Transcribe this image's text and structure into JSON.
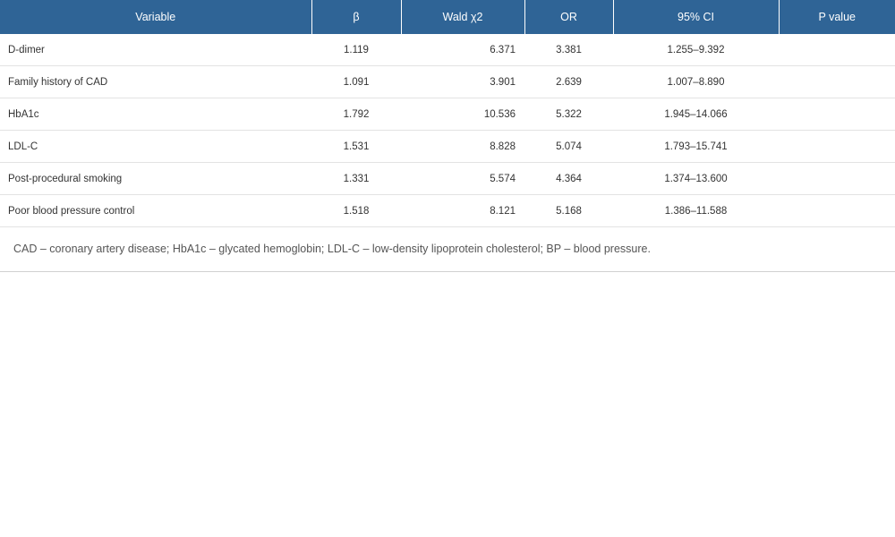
{
  "table": {
    "columns": [
      "Variable",
      "β",
      "Wald χ2",
      "OR",
      "95% CI",
      "P value"
    ],
    "rows": [
      {
        "variable": "D-dimer",
        "beta": "1.119",
        "wald": "6.371",
        "or": "3.381",
        "ci": "1.255–9.392",
        "p": ""
      },
      {
        "variable": "Family history of CAD",
        "beta": "1.091",
        "wald": "3.901",
        "or": "2.639",
        "ci": "1.007–8.890",
        "p": ""
      },
      {
        "variable": "HbA1c",
        "beta": "1.792",
        "wald": "10.536",
        "or": "5.322",
        "ci": "1.945–14.066",
        "p": ""
      },
      {
        "variable": "LDL-C",
        "beta": "1.531",
        "wald": "8.828",
        "or": "5.074",
        "ci": "1.793–15.741",
        "p": ""
      },
      {
        "variable": "Post-procedural smoking",
        "beta": "1.331",
        "wald": "5.574",
        "or": "4.364",
        "ci": "1.374–13.600",
        "p": ""
      },
      {
        "variable": "Poor blood pressure control",
        "beta": "1.518",
        "wald": "8.121",
        "or": "5.168",
        "ci": "1.386–11.588",
        "p": ""
      }
    ]
  },
  "footnote": "CAD – coronary artery disease; HbA1c – glycated hemoglobin; LDL-C – low-density lipoprotein cholesterol; BP – blood pressure.",
  "colors": {
    "header_bg": "#2f6496",
    "header_text": "#ffffff"
  }
}
